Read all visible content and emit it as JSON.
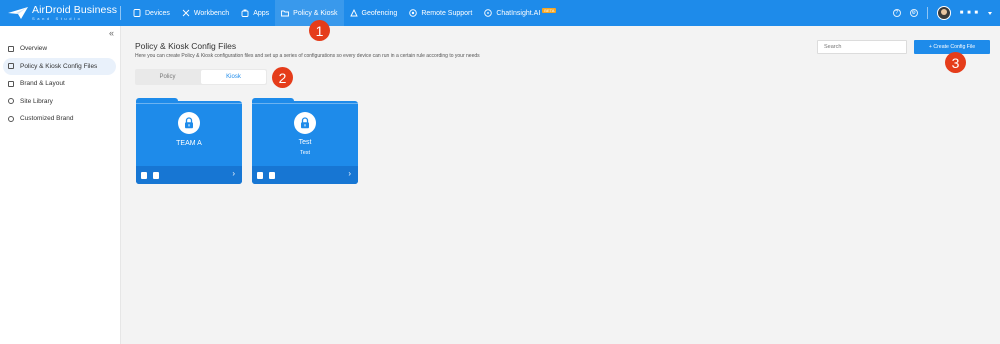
{
  "app": {
    "logo_title": "AirDroid Business",
    "logo_sub": "Sand Studio"
  },
  "nav": {
    "items": [
      {
        "label": "Devices",
        "icon": "devices-icon"
      },
      {
        "label": "Workbench",
        "icon": "workbench-icon"
      },
      {
        "label": "Apps",
        "icon": "apps-icon"
      },
      {
        "label": "Policy & Kiosk",
        "icon": "folder-icon"
      },
      {
        "label": "Geofencing",
        "icon": "geofence-icon"
      },
      {
        "label": "Remote Support",
        "icon": "remote-support-icon"
      },
      {
        "label": "ChatInsight.AI",
        "icon": "chat-icon"
      }
    ],
    "beta": "BETA",
    "active": "Policy & Kiosk",
    "user_name": "■ ■ ■"
  },
  "sidebar": {
    "items": [
      {
        "label": "Overview"
      },
      {
        "label": "Policy & Kiosk Config Files"
      },
      {
        "label": "Brand & Layout"
      },
      {
        "label": "Site Library"
      },
      {
        "label": "Customized Brand"
      }
    ]
  },
  "main": {
    "title": "Policy & Kiosk Config Files",
    "description": "Here you can create Policy & Kiosk configuration files and set up a series of configurations so every device can run in a certain rule according to your needs",
    "search_placeholder": "Search",
    "create_button": "+ Create Config File",
    "tabs": [
      {
        "label": "Policy"
      },
      {
        "label": "Kiosk"
      }
    ],
    "active_tab": "Kiosk",
    "cards": [
      {
        "name": "TEAM A",
        "sub": ""
      },
      {
        "name": "Test",
        "sub": "Test"
      }
    ]
  },
  "annotations": [
    "1",
    "2",
    "3"
  ],
  "colors": {
    "primary": "#1e8bea",
    "badge": "#e53c1a",
    "sidebar_active": "#e9f1fb"
  }
}
